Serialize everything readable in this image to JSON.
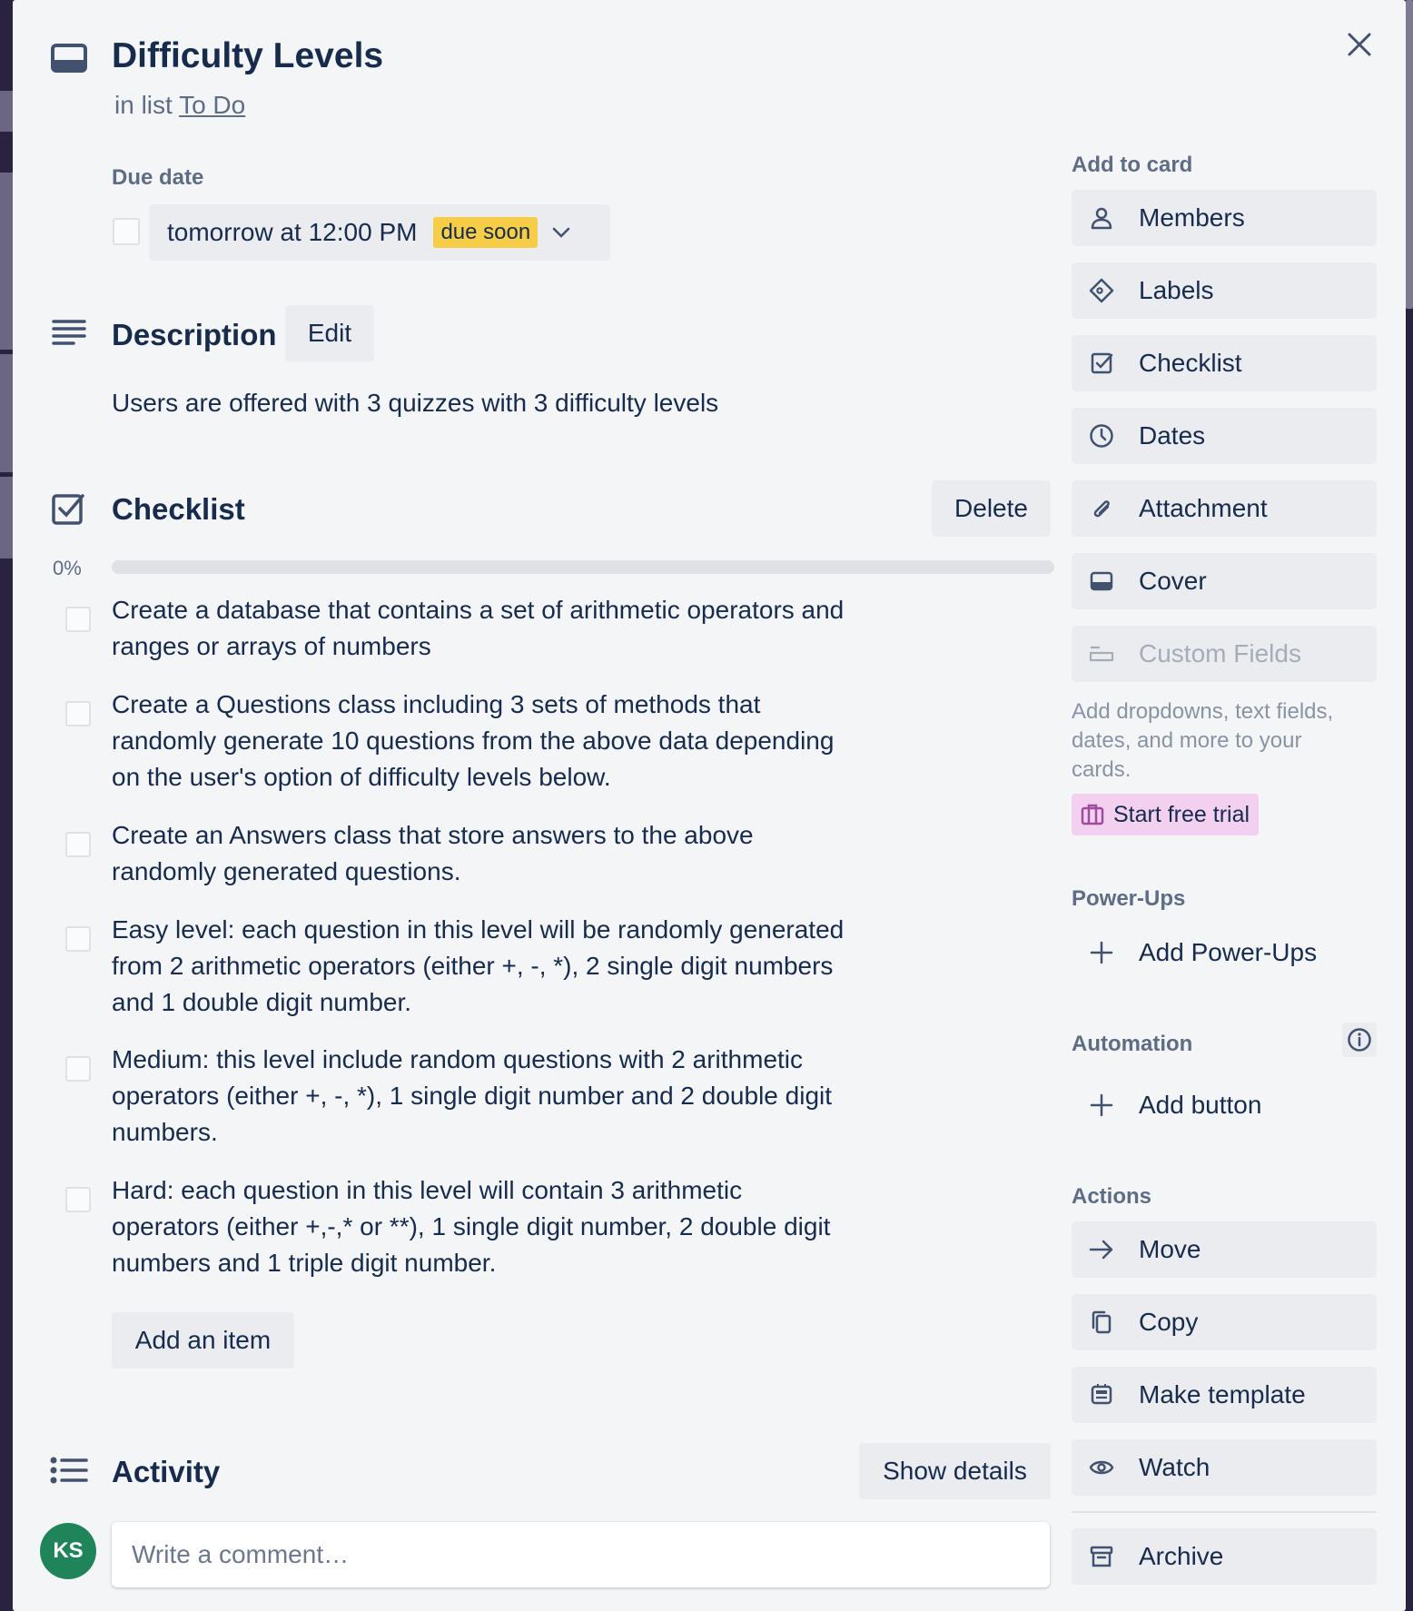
{
  "card": {
    "title": "Difficulty Levels",
    "list_prefix": "in list",
    "list_name": "To Do"
  },
  "due": {
    "label": "Due date",
    "value": "tomorrow at 12:00 PM",
    "badge": "due soon",
    "badge_color": "#f5cd47"
  },
  "description": {
    "title": "Description",
    "edit_label": "Edit",
    "text": "Users are offered with 3 quizzes with 3 difficulty levels"
  },
  "checklist": {
    "title": "Checklist",
    "delete_label": "Delete",
    "percent": "0%",
    "progress": 0,
    "items": [
      {
        "line1": "Create a database that contains a set of arithmetic operators and",
        "line2": "ranges or arrays of numbers",
        "line3": ""
      },
      {
        "line1": "Create a Questions class including 3 sets of methods that",
        "line2": "randomly generate 10 questions from the above data depending",
        "line3": "on the user's option of difficulty levels below."
      },
      {
        "line1": "Create an Answers class that store answers to the above",
        "line2": "randomly generated questions.",
        "line3": ""
      },
      {
        "line1": "Easy level: each question in this level will be randomly generated",
        "line2": "from 2 arithmetic operators (either +, -, *), 2 single digit numbers",
        "line3": "and 1 double digit number."
      },
      {
        "line1": "Medium: this level include random questions with 2 arithmetic",
        "line2": "operators (either +, -, *), 1 single digit number and 2 double digit",
        "line3": "numbers."
      },
      {
        "line1": "Hard: each question in this level will contain 3 arithmetic",
        "line2": "operators (either +,-,* or **), 1 single digit number, 2 double digit",
        "line3": "numbers and 1 triple digit number."
      }
    ],
    "add_item_label": "Add an item"
  },
  "activity": {
    "title": "Activity",
    "show_details_label": "Show details",
    "comment_placeholder": "Write a comment…",
    "avatar_initials": "KS",
    "avatar_color": "#1f845a"
  },
  "sidebar": {
    "add_to_card_title": "Add to card",
    "add_to_card": [
      {
        "label": "Members",
        "icon": "person-icon"
      },
      {
        "label": "Labels",
        "icon": "tag-icon"
      },
      {
        "label": "Checklist",
        "icon": "checkbox-icon"
      },
      {
        "label": "Dates",
        "icon": "clock-icon"
      },
      {
        "label": "Attachment",
        "icon": "paperclip-icon"
      },
      {
        "label": "Cover",
        "icon": "cover-icon"
      },
      {
        "label": "Custom Fields",
        "icon": "custom-fields-icon"
      }
    ],
    "custom_fields_hint_line1": "Add dropdowns, text fields,",
    "custom_fields_hint_line2": "dates, and more to your",
    "custom_fields_hint_line3": "cards.",
    "trial_label": "Start free trial",
    "trial_color": "#f3d0f0",
    "powerups_title": "Power-Ups",
    "add_powerups_label": "Add Power-Ups",
    "automation_title": "Automation",
    "add_button_label": "Add button",
    "actions_title": "Actions",
    "actions": [
      {
        "label": "Move",
        "icon": "arrow-right-icon"
      },
      {
        "label": "Copy",
        "icon": "copy-icon"
      },
      {
        "label": "Make template",
        "icon": "template-icon"
      },
      {
        "label": "Watch",
        "icon": "eye-icon"
      },
      {
        "label": "Archive",
        "icon": "archive-icon"
      }
    ]
  }
}
